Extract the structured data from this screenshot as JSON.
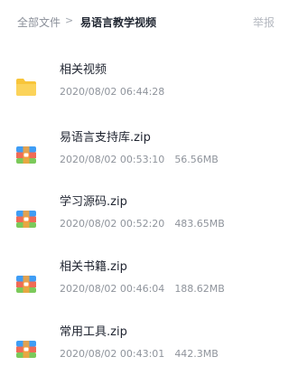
{
  "breadcrumb": {
    "root": "全部文件",
    "separator": ">",
    "current": "易语言教学视频"
  },
  "report_label": "举报",
  "files": [
    {
      "name": "相关视频",
      "date": "2020/08/02 06:44:28",
      "size": "",
      "icon": "folder-icon"
    },
    {
      "name": "易语言支持库.zip",
      "date": "2020/08/02 00:53:10",
      "size": "56.56MB",
      "icon": "zip-archive-icon"
    },
    {
      "name": "学习源码.zip",
      "date": "2020/08/02 00:52:20",
      "size": "483.65MB",
      "icon": "zip-archive-icon"
    },
    {
      "name": "相关书籍.zip",
      "date": "2020/08/02 00:46:04",
      "size": "188.62MB",
      "icon": "zip-archive-icon"
    },
    {
      "name": "常用工具.zip",
      "date": "2020/08/02 00:43:01",
      "size": "442.3MB",
      "icon": "zip-archive-icon"
    }
  ],
  "colors": {
    "folder": "#f8c53a",
    "zip_top": "#3f9df5",
    "zip_mid": "#f06a55",
    "zip_bottom": "#7bc95a",
    "zip_band": "#f3a33f"
  }
}
